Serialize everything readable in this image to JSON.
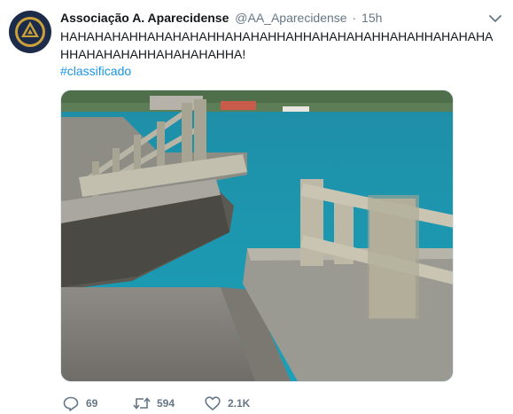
{
  "tweet": {
    "author_name": "Associação A. Aparecidense",
    "handle": "@AA_Aparecidense",
    "separator": "·",
    "time": "15h",
    "text": "HAHAHAHAHHAHAHAHAHHAHAHAHHAHHAHAHAHAHHAHAHHAHAHAHAHHAHAHAHAHHAHAHAHAHHA!",
    "hashtag": "#classificado"
  },
  "actions": {
    "reply_count": "69",
    "retweet_count": "594",
    "like_count": "2.1K"
  },
  "icons": {
    "avatar": "club-crest-icon",
    "caret": "chevron-down-icon",
    "reply": "reply-icon",
    "retweet": "retweet-icon",
    "like": "heart-icon"
  },
  "colors": {
    "link": "#1b95e0",
    "secondary_text": "#657786",
    "primary_text": "#14171a"
  }
}
